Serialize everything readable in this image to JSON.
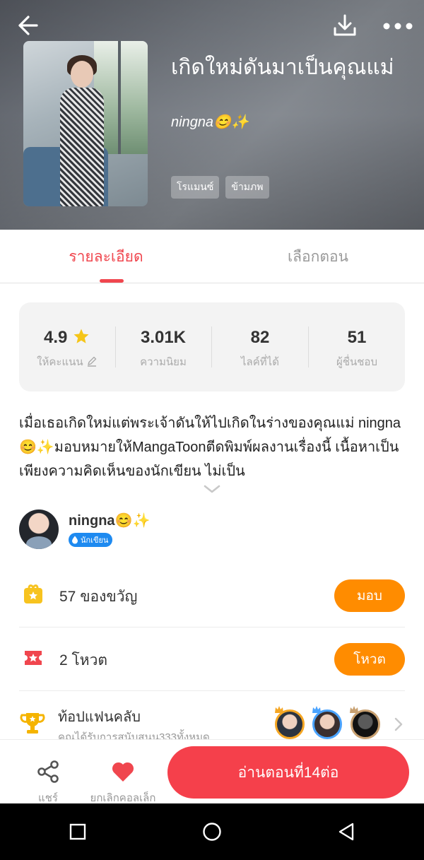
{
  "header": {
    "title": "เกิดใหม่ดันมาเป็นคุณแม่",
    "author": "ningna😊✨",
    "tags": [
      "โรแมนซ์",
      "ข้ามภพ"
    ],
    "icons": {
      "back": "arrow-left-icon",
      "download": "download-icon",
      "more": "more-dots-icon"
    }
  },
  "tabs": {
    "details": "รายละเอียด",
    "episodes": "เลือกตอน"
  },
  "stats": [
    {
      "value": "4.9",
      "label": "ให้คะแนน",
      "icon": "star-icon"
    },
    {
      "value": "3.01K",
      "label": "ความนิยม"
    },
    {
      "value": "82",
      "label": "ไลค์ที่ได้"
    },
    {
      "value": "51",
      "label": "ผู้ชื่นชอบ"
    }
  ],
  "description": "เมื่อเธอเกิดใหม่แต่พระเจ้าดันให้ไปเกิดในร่างของคุณแม่ ningna😊✨มอบหมายให้MangaToonตีดพิมพ์ผลงานเรื่องนี้ เนื้อหาเป็นเพียงความคิดเห็นของนักเขียน ไม่เป็น",
  "author": {
    "name": "ningna😊✨",
    "badge": "นักเขียน"
  },
  "gift_row": {
    "text": "57 ของขวัญ",
    "button": "มอบ"
  },
  "vote_row": {
    "text": "2 โหวต",
    "button": "โหวต"
  },
  "fan_club": {
    "title": "ท้อปแฟนคลับ",
    "subtitle": "คุณได้รับการสนับสนุน333ทั้งหมด"
  },
  "bottom_bar": {
    "share": "แชร์",
    "favorite": "ยกเลิกคอลเล็ก",
    "read": "อ่านตอนที่14ต่อ"
  },
  "colors": {
    "accent": "#f0464e",
    "orange": "#ff8c00",
    "read_button": "#f5404b",
    "gold": "#f5c518"
  }
}
